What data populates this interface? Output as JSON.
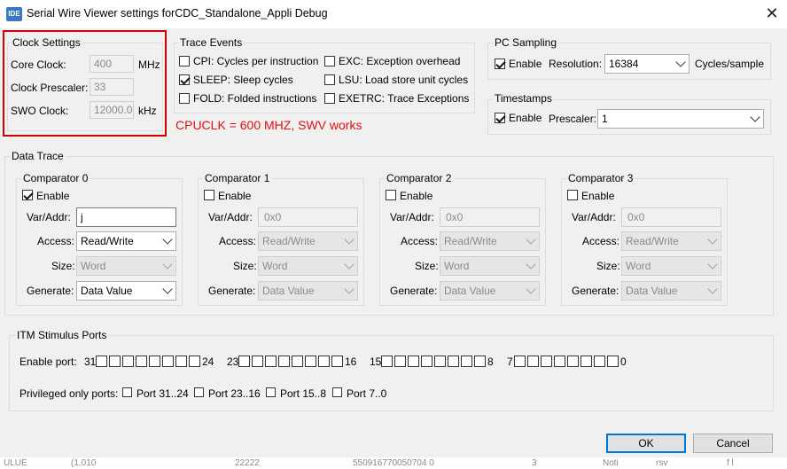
{
  "window": {
    "app_icon": "IDE",
    "title": "Serial Wire Viewer settings forCDC_Standalone_Appli Debug",
    "close": "✕"
  },
  "clock_settings": {
    "title": "Clock Settings",
    "core_clock_label": "Core Clock:",
    "core_clock_value": "400",
    "core_clock_unit": "MHz",
    "prescaler_label": "Clock Prescaler:",
    "prescaler_value": "33",
    "swo_label": "SWO Clock:",
    "swo_value": "12000.0",
    "swo_unit": "kHz"
  },
  "trace_events": {
    "title": "Trace Events",
    "items": [
      {
        "label": "CPI: Cycles per instruction",
        "checked": false
      },
      {
        "label": "SLEEP: Sleep cycles",
        "checked": true
      },
      {
        "label": "FOLD: Folded instructions",
        "checked": false
      },
      {
        "label": "EXC: Exception overhead",
        "checked": false
      },
      {
        "label": "LSU: Load store unit cycles",
        "checked": false
      },
      {
        "label": "EXETRC: Trace Exceptions",
        "checked": false
      }
    ]
  },
  "annotation": "CPUCLK = 600 MHZ, SWV works",
  "pc_sampling": {
    "title": "PC Sampling",
    "enable_label": "Enable",
    "resolution_label": "Resolution:",
    "resolution_value": "16384",
    "unit": "Cycles/sample"
  },
  "timestamps": {
    "title": "Timestamps",
    "enable_label": "Enable",
    "prescaler_label": "Prescaler:",
    "prescaler_value": "1"
  },
  "data_trace": {
    "title": "Data Trace",
    "field_labels": {
      "enable": "Enable",
      "var_addr": "Var/Addr:",
      "access": "Access:",
      "size": "Size:",
      "generate": "Generate:"
    },
    "comparators": [
      {
        "title": "Comparator 0",
        "enabled": true,
        "var_addr": "j",
        "access": "Read/Write",
        "size": "Word",
        "generate": "Data Value"
      },
      {
        "title": "Comparator 1",
        "enabled": false,
        "var_addr": "0x0",
        "access": "Read/Write",
        "size": "Word",
        "generate": "Data Value"
      },
      {
        "title": "Comparator 2",
        "enabled": false,
        "var_addr": "0x0",
        "access": "Read/Write",
        "size": "Word",
        "generate": "Data Value"
      },
      {
        "title": "Comparator 3",
        "enabled": false,
        "var_addr": "0x0",
        "access": "Read/Write",
        "size": "Word",
        "generate": "Data Value"
      }
    ]
  },
  "itm": {
    "title": "ITM Stimulus Ports",
    "enable_port_label": "Enable port:",
    "groups": [
      {
        "start": "31",
        "end": "24"
      },
      {
        "start": "23",
        "end": "16"
      },
      {
        "start": "15",
        "end": "8"
      },
      {
        "start": "7",
        "end": "0"
      }
    ],
    "privileged_label": "Privileged only ports:",
    "privileged": [
      "Port 31..24",
      "Port 23..16",
      "Port 15..8",
      "Port 7..0"
    ]
  },
  "buttons": {
    "ok": "OK",
    "cancel": "Cancel"
  },
  "bottom_strip": {
    "c1": "ULUE",
    "c2": "(1.010",
    "c3": "22222",
    "c4": "550916770050704 0",
    "c5": "3",
    "c6": "Noti",
    "c7": "rsv",
    "c8": "f l"
  }
}
